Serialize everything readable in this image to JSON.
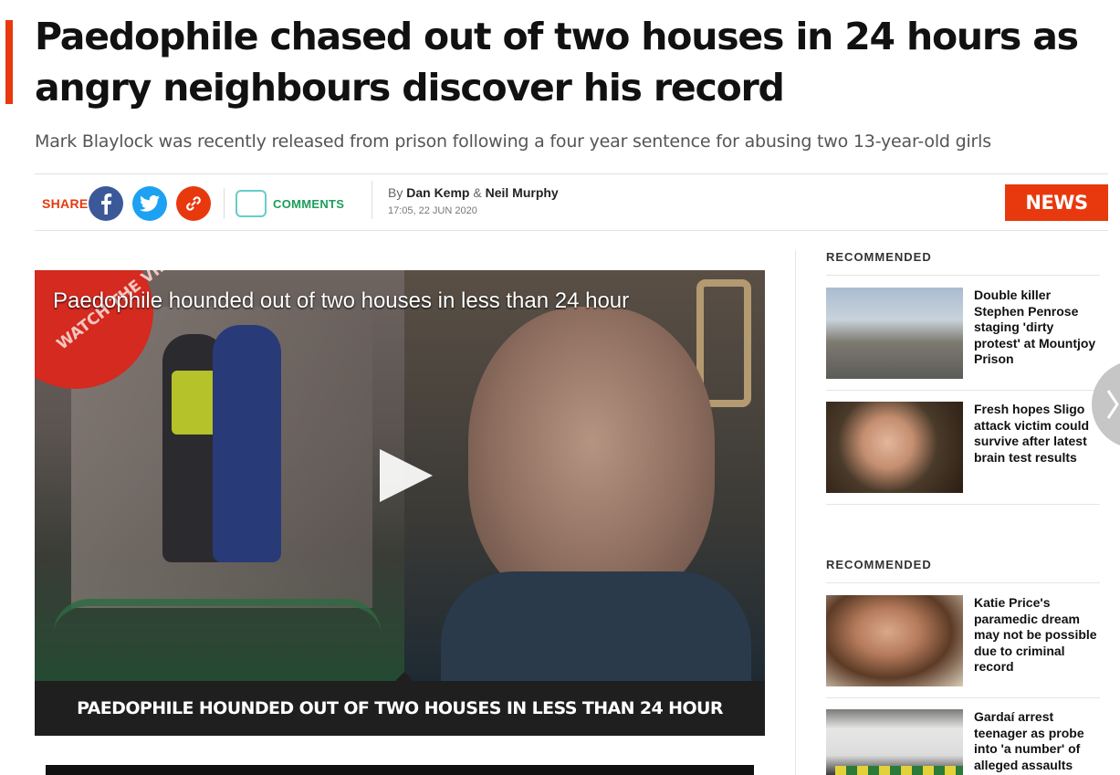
{
  "article": {
    "headline": "Paedophile chased out of two houses in 24 hours as angry neighbours discover his record",
    "subheadline": "Mark Blaylock was recently released from prison following a four year sentence for abusing two 13-year-old girls",
    "share_label": "SHARE",
    "comments_label": "COMMENTS",
    "by_prefix": "By",
    "author1": "Dan Kemp",
    "author_joiner": "&",
    "author2": "Neil Murphy",
    "timestamp": "17:05, 22 JUN 2020",
    "section_badge": "NEWS"
  },
  "video": {
    "overlay_title": "Paedophile hounded out of two houses in less than 24 hour",
    "badge_text": "WATCH THE VIDEO",
    "caption": "PAEDOPHILE HOUNDED OUT OF TWO HOUSES IN LESS THAN 24 HOUR"
  },
  "sidebar": {
    "sections": [
      {
        "heading": "RECOMMENDED",
        "items": [
          {
            "title": "Double killer Stephen Penrose staging 'dirty protest' at Mountjoy Prison"
          },
          {
            "title": "Fresh hopes Sligo attack victim could survive after latest brain test results"
          }
        ]
      },
      {
        "heading": "RECOMMENDED",
        "items": [
          {
            "title": "Katie Price's paramedic dream may not be possible due to criminal record"
          },
          {
            "title": "Gardaí arrest teenager as probe into 'a number' of alleged assaults"
          }
        ]
      }
    ]
  },
  "colors": {
    "accent": "#e8380d",
    "facebook": "#3b5998",
    "twitter": "#1da1f2",
    "comments": "#1b9e5a"
  },
  "icons": {
    "facebook": "facebook-icon",
    "twitter": "twitter-icon",
    "link": "link-icon",
    "comments": "comment-bubble-icon",
    "play": "play-icon",
    "next": "chevron-right-icon"
  }
}
